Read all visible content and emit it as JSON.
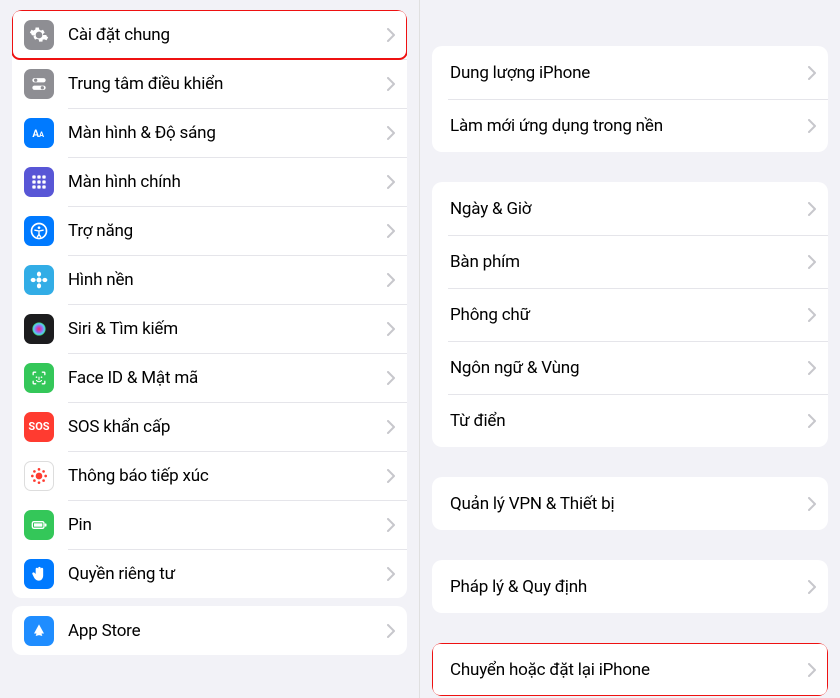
{
  "left": {
    "group1": [
      {
        "icon": "gear-icon",
        "iconClass": "ic-gray",
        "label": "Cài đặt chung",
        "highlight": true
      },
      {
        "icon": "switches-icon",
        "iconClass": "ic-gray2",
        "label": "Trung tâm điều khiển",
        "highlight": false
      },
      {
        "icon": "text-size-icon",
        "iconClass": "ic-blue",
        "label": "Màn hình & Độ sáng",
        "highlight": false
      },
      {
        "icon": "grid-icon",
        "iconClass": "ic-purple",
        "label": "Màn hình chính",
        "highlight": false
      },
      {
        "icon": "accessibility-icon",
        "iconClass": "ic-blue",
        "label": "Trợ năng",
        "highlight": false
      },
      {
        "icon": "flower-icon",
        "iconClass": "ic-teal",
        "label": "Hình nền",
        "highlight": false
      },
      {
        "icon": "siri-icon",
        "iconClass": "ic-dark",
        "label": "Siri & Tìm kiếm",
        "highlight": false
      },
      {
        "icon": "faceid-icon",
        "iconClass": "ic-green",
        "label": "Face ID & Mật mã",
        "highlight": false
      },
      {
        "icon": "sos-icon",
        "iconClass": "ic-red-sos",
        "label": "SOS khẩn cấp",
        "highlight": false
      },
      {
        "icon": "exposure-icon",
        "iconClass": "ic-white",
        "label": "Thông báo tiếp xúc",
        "highlight": false
      },
      {
        "icon": "battery-icon",
        "iconClass": "ic-green",
        "label": "Pin",
        "highlight": false
      },
      {
        "icon": "hand-icon",
        "iconClass": "ic-hand",
        "label": "Quyền riêng tư",
        "highlight": false
      }
    ],
    "group2": [
      {
        "icon": "appstore-icon",
        "iconClass": "ic-appstore",
        "label": "App Store",
        "highlight": false
      }
    ]
  },
  "right": {
    "group1": [
      {
        "label": "Dung lượng iPhone",
        "highlight": false
      },
      {
        "label": "Làm mới ứng dụng trong nền",
        "highlight": false
      }
    ],
    "group2": [
      {
        "label": "Ngày & Giờ",
        "highlight": false
      },
      {
        "label": "Bàn phím",
        "highlight": false
      },
      {
        "label": "Phông chữ",
        "highlight": false
      },
      {
        "label": "Ngôn ngữ & Vùng",
        "highlight": false
      },
      {
        "label": "Từ điển",
        "highlight": false
      }
    ],
    "group3": [
      {
        "label": "Quản lý VPN & Thiết bị",
        "highlight": false
      }
    ],
    "group4": [
      {
        "label": "Pháp lý & Quy định",
        "highlight": false
      }
    ],
    "group5": [
      {
        "label": "Chuyển hoặc đặt lại iPhone",
        "highlight": true
      }
    ]
  },
  "colors": {
    "highlight_border": "#e11",
    "bg": "#f2f2f7",
    "chevron": "#c7c7cc"
  }
}
